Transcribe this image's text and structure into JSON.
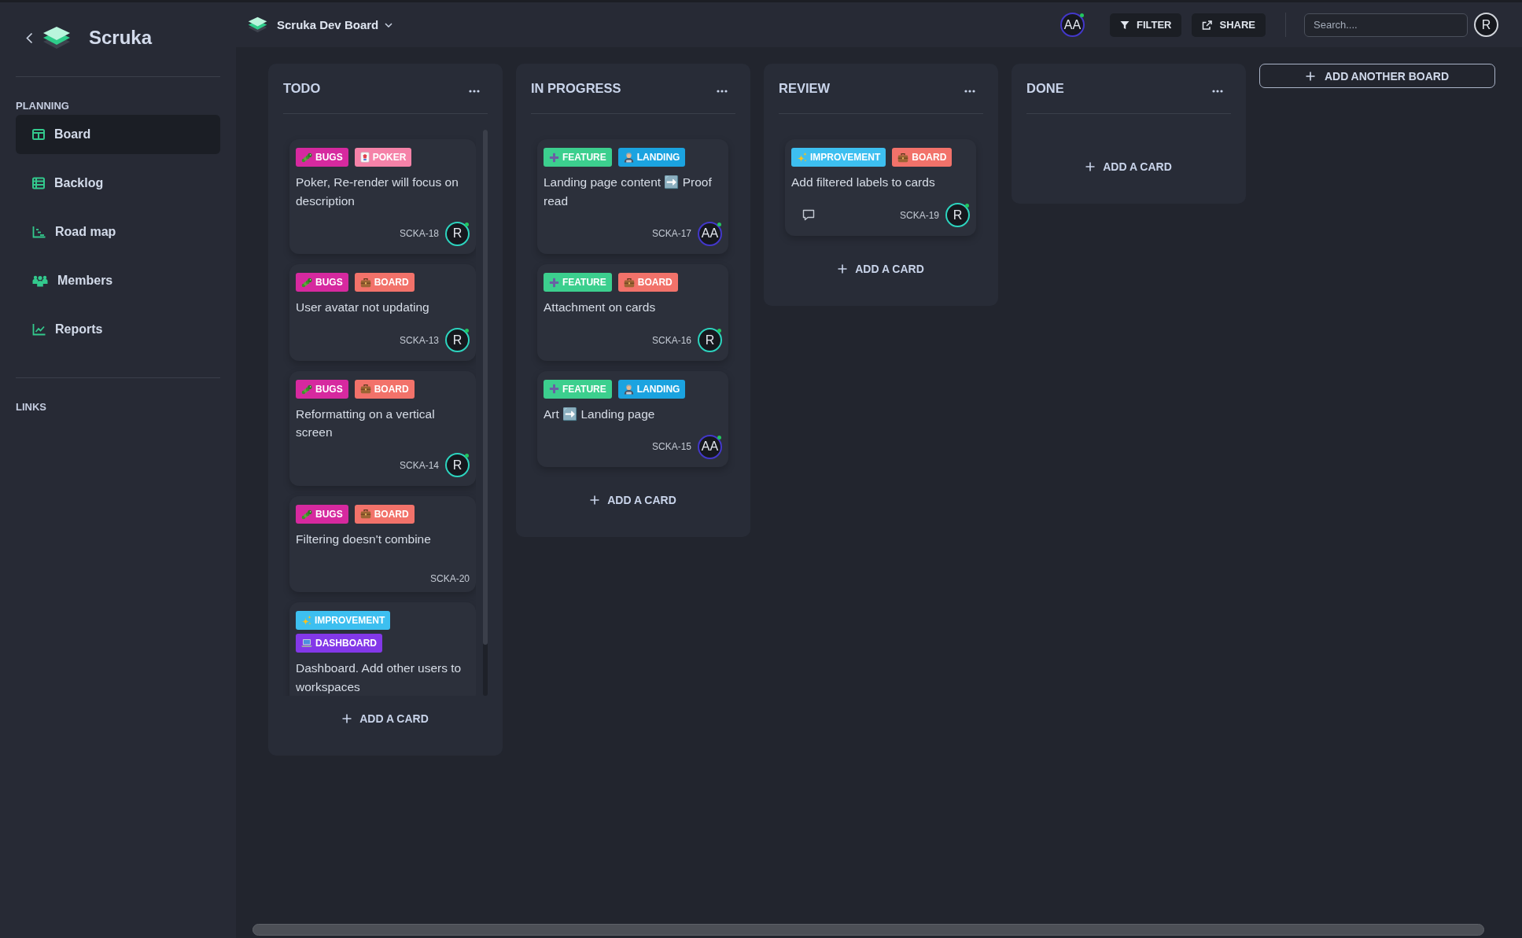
{
  "sidebar": {
    "app_name": "Scruka",
    "sections": [
      {
        "title": "PLANNING",
        "items": [
          {
            "label": "Board",
            "kind": "board",
            "selected": true
          },
          {
            "label": "Backlog",
            "kind": "backlog",
            "selected": false
          },
          {
            "label": "Road map",
            "kind": "roadmap",
            "selected": false
          },
          {
            "label": "Members",
            "kind": "members",
            "selected": false
          },
          {
            "label": "Reports",
            "kind": "reports",
            "selected": false
          }
        ]
      },
      {
        "title": "LINKS"
      }
    ]
  },
  "header": {
    "board_title": "Scruka Dev Board",
    "members": [
      {
        "initials": "AA",
        "color": "#4338ca",
        "online": true
      }
    ],
    "actions": [
      {
        "label": "FILTER",
        "kind": "filter"
      },
      {
        "label": "SHARE",
        "kind": "share"
      }
    ],
    "search": {
      "placeholder": "Search...."
    },
    "user": {
      "initials": "R",
      "color": "#d1d5db",
      "online": false
    }
  },
  "columns": [
    {
      "title": "TODO",
      "scrollable": true,
      "cards": [
        {
          "labels": [
            {
              "text": "BUGS",
              "kind": "bugs",
              "color": "#d6299f"
            },
            {
              "text": "POKER",
              "kind": "poker",
              "color": "#f582a8"
            }
          ],
          "title": "Poker, Re-render will focus on description",
          "key": "SCKA-18",
          "assignee": {
            "initials": "R",
            "color": "#2dd4bf",
            "online": true
          },
          "comment": false
        },
        {
          "labels": [
            {
              "text": "BUGS",
              "kind": "bugs",
              "color": "#d6299f"
            },
            {
              "text": "BOARD",
              "kind": "board",
              "color": "#f2726a"
            }
          ],
          "title": "User avatar not updating",
          "key": "SCKA-13",
          "assignee": {
            "initials": "R",
            "color": "#2dd4bf",
            "online": true
          },
          "comment": false
        },
        {
          "labels": [
            {
              "text": "BUGS",
              "kind": "bugs",
              "color": "#d6299f"
            },
            {
              "text": "BOARD",
              "kind": "board",
              "color": "#f2726a"
            }
          ],
          "title": "Reformatting on a vertical screen",
          "key": "SCKA-14",
          "assignee": {
            "initials": "R",
            "color": "#2dd4bf",
            "online": true
          },
          "comment": false
        },
        {
          "labels": [
            {
              "text": "BUGS",
              "kind": "bugs",
              "color": "#d6299f"
            },
            {
              "text": "BOARD",
              "kind": "board",
              "color": "#f2726a"
            }
          ],
          "title": "Filtering doesn't combine",
          "key": "SCKA-20",
          "comment": false
        },
        {
          "labels": [
            {
              "text": "IMPROVEMENT",
              "kind": "improvement",
              "color": "#3dbff0"
            },
            {
              "text": "DASHBOARD",
              "kind": "dashboard",
              "color": "#8338e8"
            }
          ],
          "title": "Dashboard. Add other users to workspaces",
          "comment": false
        }
      ],
      "add_label": "ADD A CARD"
    },
    {
      "title": "IN PROGRESS",
      "scrollable": false,
      "cards": [
        {
          "labels": [
            {
              "text": "FEATURE",
              "kind": "feature",
              "color": "#3ccf8e"
            },
            {
              "text": "LANDING",
              "kind": "landing",
              "color": "#1ba3e0"
            }
          ],
          "title": "Landing page content ➡️ Proof read",
          "key": "SCKA-17",
          "assignee": {
            "initials": "AA",
            "color": "#4338ca",
            "online": true
          },
          "comment": false
        },
        {
          "labels": [
            {
              "text": "FEATURE",
              "kind": "feature",
              "color": "#3ccf8e"
            },
            {
              "text": "BOARD",
              "kind": "board",
              "color": "#f2726a"
            }
          ],
          "title": "Attachment on cards",
          "key": "SCKA-16",
          "assignee": {
            "initials": "R",
            "color": "#2dd4bf",
            "online": true
          },
          "comment": false
        },
        {
          "labels": [
            {
              "text": "FEATURE",
              "kind": "feature",
              "color": "#3ccf8e"
            },
            {
              "text": "LANDING",
              "kind": "landing",
              "color": "#1ba3e0"
            }
          ],
          "title": "Art ➡️ Landing page",
          "key": "SCKA-15",
          "assignee": {
            "initials": "AA",
            "color": "#4338ca",
            "online": true
          },
          "comment": false
        }
      ],
      "add_label": "ADD A CARD"
    },
    {
      "title": "REVIEW",
      "scrollable": false,
      "cards": [
        {
          "labels": [
            {
              "text": "IMPROVEMENT",
              "kind": "improvement",
              "color": "#3dbff0"
            },
            {
              "text": "BOARD",
              "kind": "board",
              "color": "#f2726a"
            }
          ],
          "title": "Add filtered labels to cards",
          "key": "SCKA-19",
          "assignee": {
            "initials": "R",
            "color": "#2dd4bf",
            "online": true
          },
          "comment": true
        }
      ],
      "add_label": "ADD A CARD"
    },
    {
      "title": "DONE",
      "scrollable": false,
      "add_label": "ADD A CARD"
    }
  ],
  "add_board_label": "ADD ANOTHER BOARD"
}
